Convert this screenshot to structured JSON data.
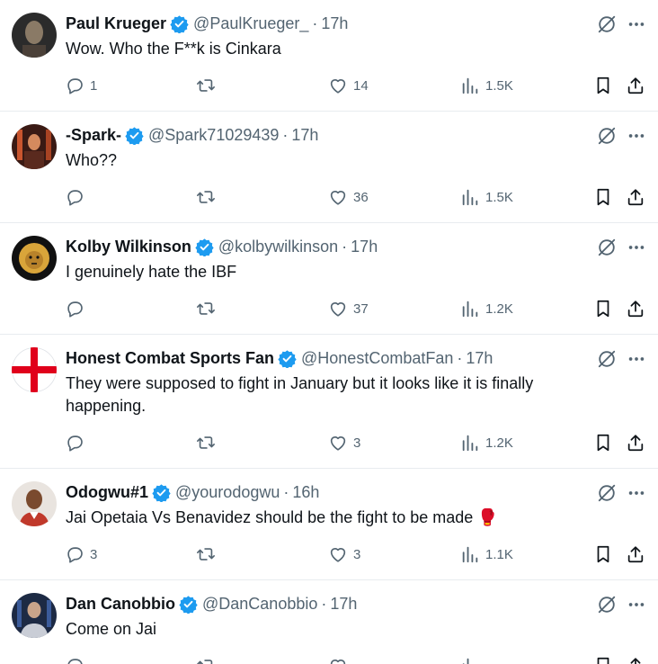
{
  "tweets": [
    {
      "name": "Paul Krueger",
      "handle": "@PaulKrueger_",
      "dot": "·",
      "time": "17h",
      "text": "Wow. Who the F**k is Cinkara",
      "replies": "1",
      "retweets": "",
      "likes": "14",
      "views": "1.5K",
      "avatar_colors": [
        "#2b2b2b",
        "#8a7a66"
      ]
    },
    {
      "name": "-Spark-",
      "handle": "@Spark71029439",
      "dot": "·",
      "time": "17h",
      "text": "Who??",
      "replies": "",
      "retweets": "",
      "likes": "36",
      "views": "1.5K",
      "avatar_colors": [
        "#3a1a14",
        "#c9552e"
      ]
    },
    {
      "name": "Kolby Wilkinson",
      "handle": "@kolbywilkinson",
      "dot": "·",
      "time": "17h",
      "text": "I genuinely hate the IBF",
      "replies": "",
      "retweets": "",
      "likes": "37",
      "views": "1.2K",
      "avatar_colors": [
        "#111111",
        "#d9a53a"
      ]
    },
    {
      "name": "Honest Combat Sports Fan",
      "handle": "@HonestCombatFan",
      "dot": "·",
      "time": "17h",
      "text": "They were supposed to fight in January but it looks like it is finally happening.",
      "replies": "",
      "retweets": "",
      "likes": "3",
      "views": "1.2K",
      "avatar_colors": [
        "#ffffff",
        "#e0001b"
      ]
    },
    {
      "name": "Odogwu#1",
      "handle": "@yourodogwu",
      "dot": "·",
      "time": "16h",
      "text": "Jai Opetaia Vs Benavidez should be the fight to be made 🥊",
      "replies": "3",
      "retweets": "",
      "likes": "3",
      "views": "1.1K",
      "avatar_colors": [
        "#c0392b",
        "#7a4a2e"
      ]
    },
    {
      "name": "Dan Canobbio",
      "handle": "@DanCanobbio",
      "dot": "·",
      "time": "17h",
      "text": "Come on Jai",
      "replies": "",
      "retweets": "",
      "likes": "",
      "views": "",
      "avatar_colors": [
        "#1d2a44",
        "#c9cdd6"
      ]
    }
  ],
  "colors": {
    "verified": "#1d9bf0",
    "muted": "#536471",
    "text": "#0f1419",
    "divider": "#e8ecef"
  },
  "icons": {
    "verified": "verified-badge-icon",
    "grok": "grok-icon",
    "more": "more-icon",
    "reply": "reply-icon",
    "retweet": "retweet-icon",
    "like": "heart-icon",
    "views": "views-icon",
    "bookmark": "bookmark-icon",
    "share": "share-icon"
  }
}
